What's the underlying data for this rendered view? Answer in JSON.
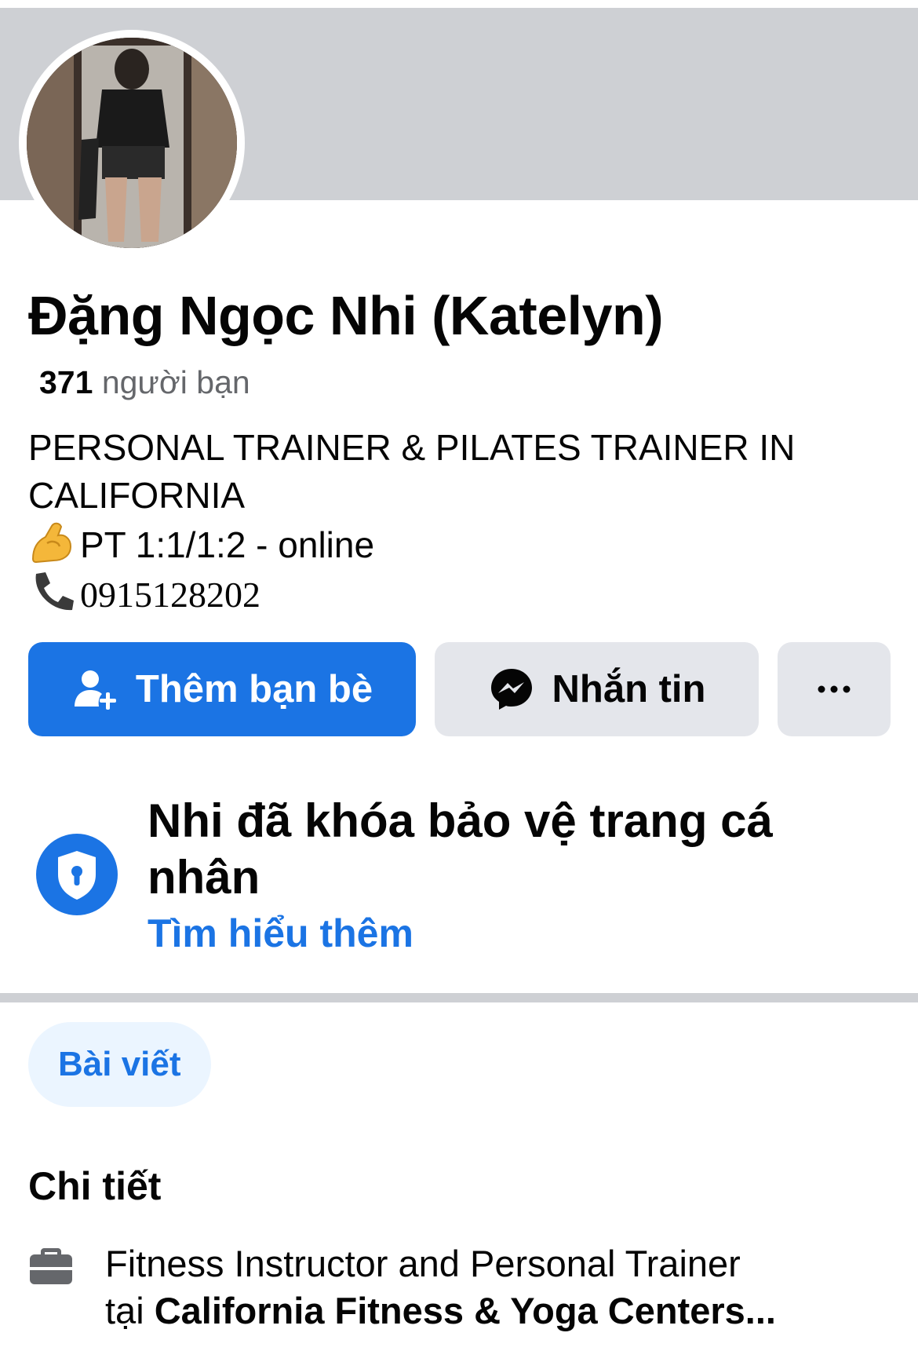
{
  "profile": {
    "name": "Đặng Ngọc Nhi (Katelyn)",
    "friends_count": "371",
    "friends_label": "người bạn",
    "bio": {
      "line1": "PERSONAL TRAINER & PILATES TRAINER IN",
      "line2": "CALIFORNIA",
      "line3": "PT 1:1/1:2 - online",
      "line4": "0915128202",
      "line3_icon": "flexed-biceps-emoji",
      "line4_icon": "telephone-receiver-emoji"
    }
  },
  "actions": {
    "add_friend": "Thêm bạn bè",
    "message": "Nhắn tin",
    "more": "more-dots-icon"
  },
  "locked_notice": {
    "title": "Nhi đã khóa bảo vệ trang cá nhân",
    "link": "Tìm hiểu thêm"
  },
  "tabs": {
    "posts": "Bài viết"
  },
  "details": {
    "title": "Chi tiết",
    "work_prefix": "Fitness Instructor and Personal Trainer",
    "work_at": "tại",
    "work_place": "California Fitness & Yoga Centers..."
  },
  "colors": {
    "brand_blue": "#1b74e4",
    "cover_gray": "#ced0d4",
    "secondary_button": "#e4e6eb",
    "secondary_text": "#65676b"
  }
}
